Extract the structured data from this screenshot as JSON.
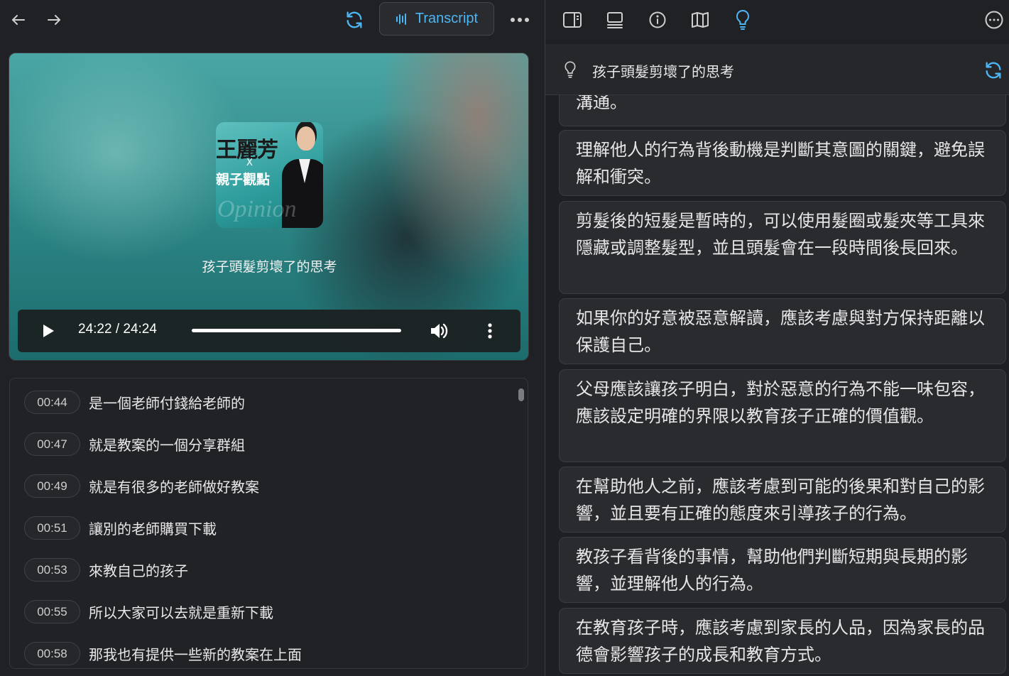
{
  "left_toolbar": {
    "back_icon": "arrow-left-icon",
    "forward_icon": "arrow-right-icon",
    "refresh_icon": "refresh-icon",
    "transcript_label": "Transcript",
    "more_icon": "more-horizontal-icon"
  },
  "video": {
    "thumbnail": {
      "name_text": "王麗芳",
      "x_text": "X",
      "show_text": "親子觀點",
      "brand_text": "Opinion"
    },
    "title": "孩子頭髮剪壞了的思考",
    "player": {
      "time": "24:22 / 24:24",
      "progress_fraction": 0.9986
    }
  },
  "transcript": [
    {
      "time": "00:44",
      "text": "是一個老師付錢給老師的"
    },
    {
      "time": "00:47",
      "text": "就是教案的一個分享群組"
    },
    {
      "time": "00:49",
      "text": "就是有很多的老師做好教案"
    },
    {
      "time": "00:51",
      "text": "讓別的老師購買下載"
    },
    {
      "time": "00:53",
      "text": "來教自己的孩子"
    },
    {
      "time": "00:55",
      "text": "所以大家可以去就是重新下載"
    },
    {
      "time": "00:58",
      "text": "那我也有提供一些新的教案在上面"
    }
  ],
  "right_toolbar": {
    "icons": [
      "sidebar-panel-icon",
      "layout-bottom-icon",
      "info-icon",
      "book-open-icon",
      "lightbulb-icon"
    ],
    "more_icon": "more-circle-icon",
    "accent_color": "#4cb6f5"
  },
  "insights": {
    "title": "孩子頭髮剪壞了的思考",
    "cards": [
      "溝通。",
      "理解他人的行為背後動機是判斷其意圖的關鍵，避免誤解和衝突。",
      "剪髮後的短髮是暫時的，可以使用髮圈或髮夾等工具來隱藏或調整髮型，並且頭髮會在一段時間後長回來。",
      "如果你的好意被惡意解讀，應該考慮與對方保持距離以保護自己。",
      "父母應該讓孩子明白，對於惡意的行為不能一味包容，應該設定明確的界限以教育孩子正確的價值觀。",
      "在幫助他人之前，應該考慮到可能的後果和對自己的影響，並且要有正確的態度來引導孩子的行為。",
      "教孩子看背後的事情，幫助他們判斷短期與長期的影響，並理解他人的行為。",
      "在教育孩子時，應該考慮到家長的人品，因為家長的品德會影響孩子的成長和教育方式。"
    ]
  }
}
